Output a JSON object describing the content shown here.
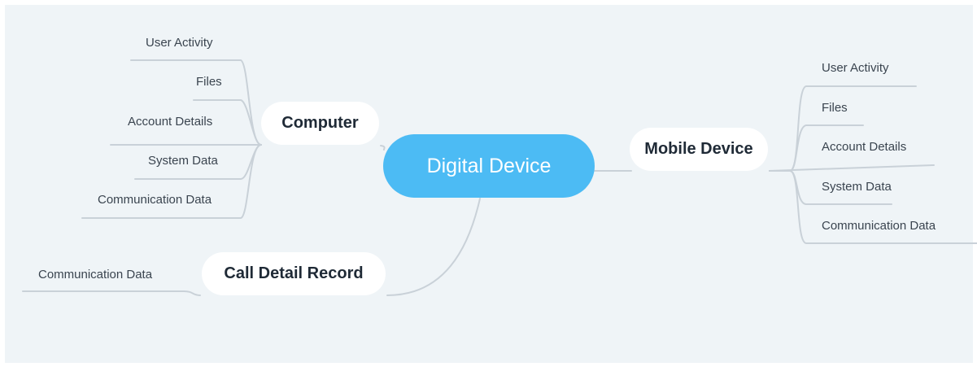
{
  "root": {
    "label": "Digital Device"
  },
  "branches": {
    "computer": {
      "label": "Computer",
      "children": [
        "User Activity",
        "Files",
        "Account Details",
        "System Data",
        "Communication Data"
      ]
    },
    "mobile": {
      "label": "Mobile Device",
      "children": [
        "User Activity",
        "Files",
        "Account Details",
        "System Data",
        "Communication Data"
      ]
    },
    "cdr": {
      "label": "Call Detail Record",
      "children": [
        "Communication Data"
      ]
    }
  },
  "colors": {
    "root": "#4cbbf4",
    "background": "#eff4f7",
    "connector": "#c9d1d8"
  }
}
